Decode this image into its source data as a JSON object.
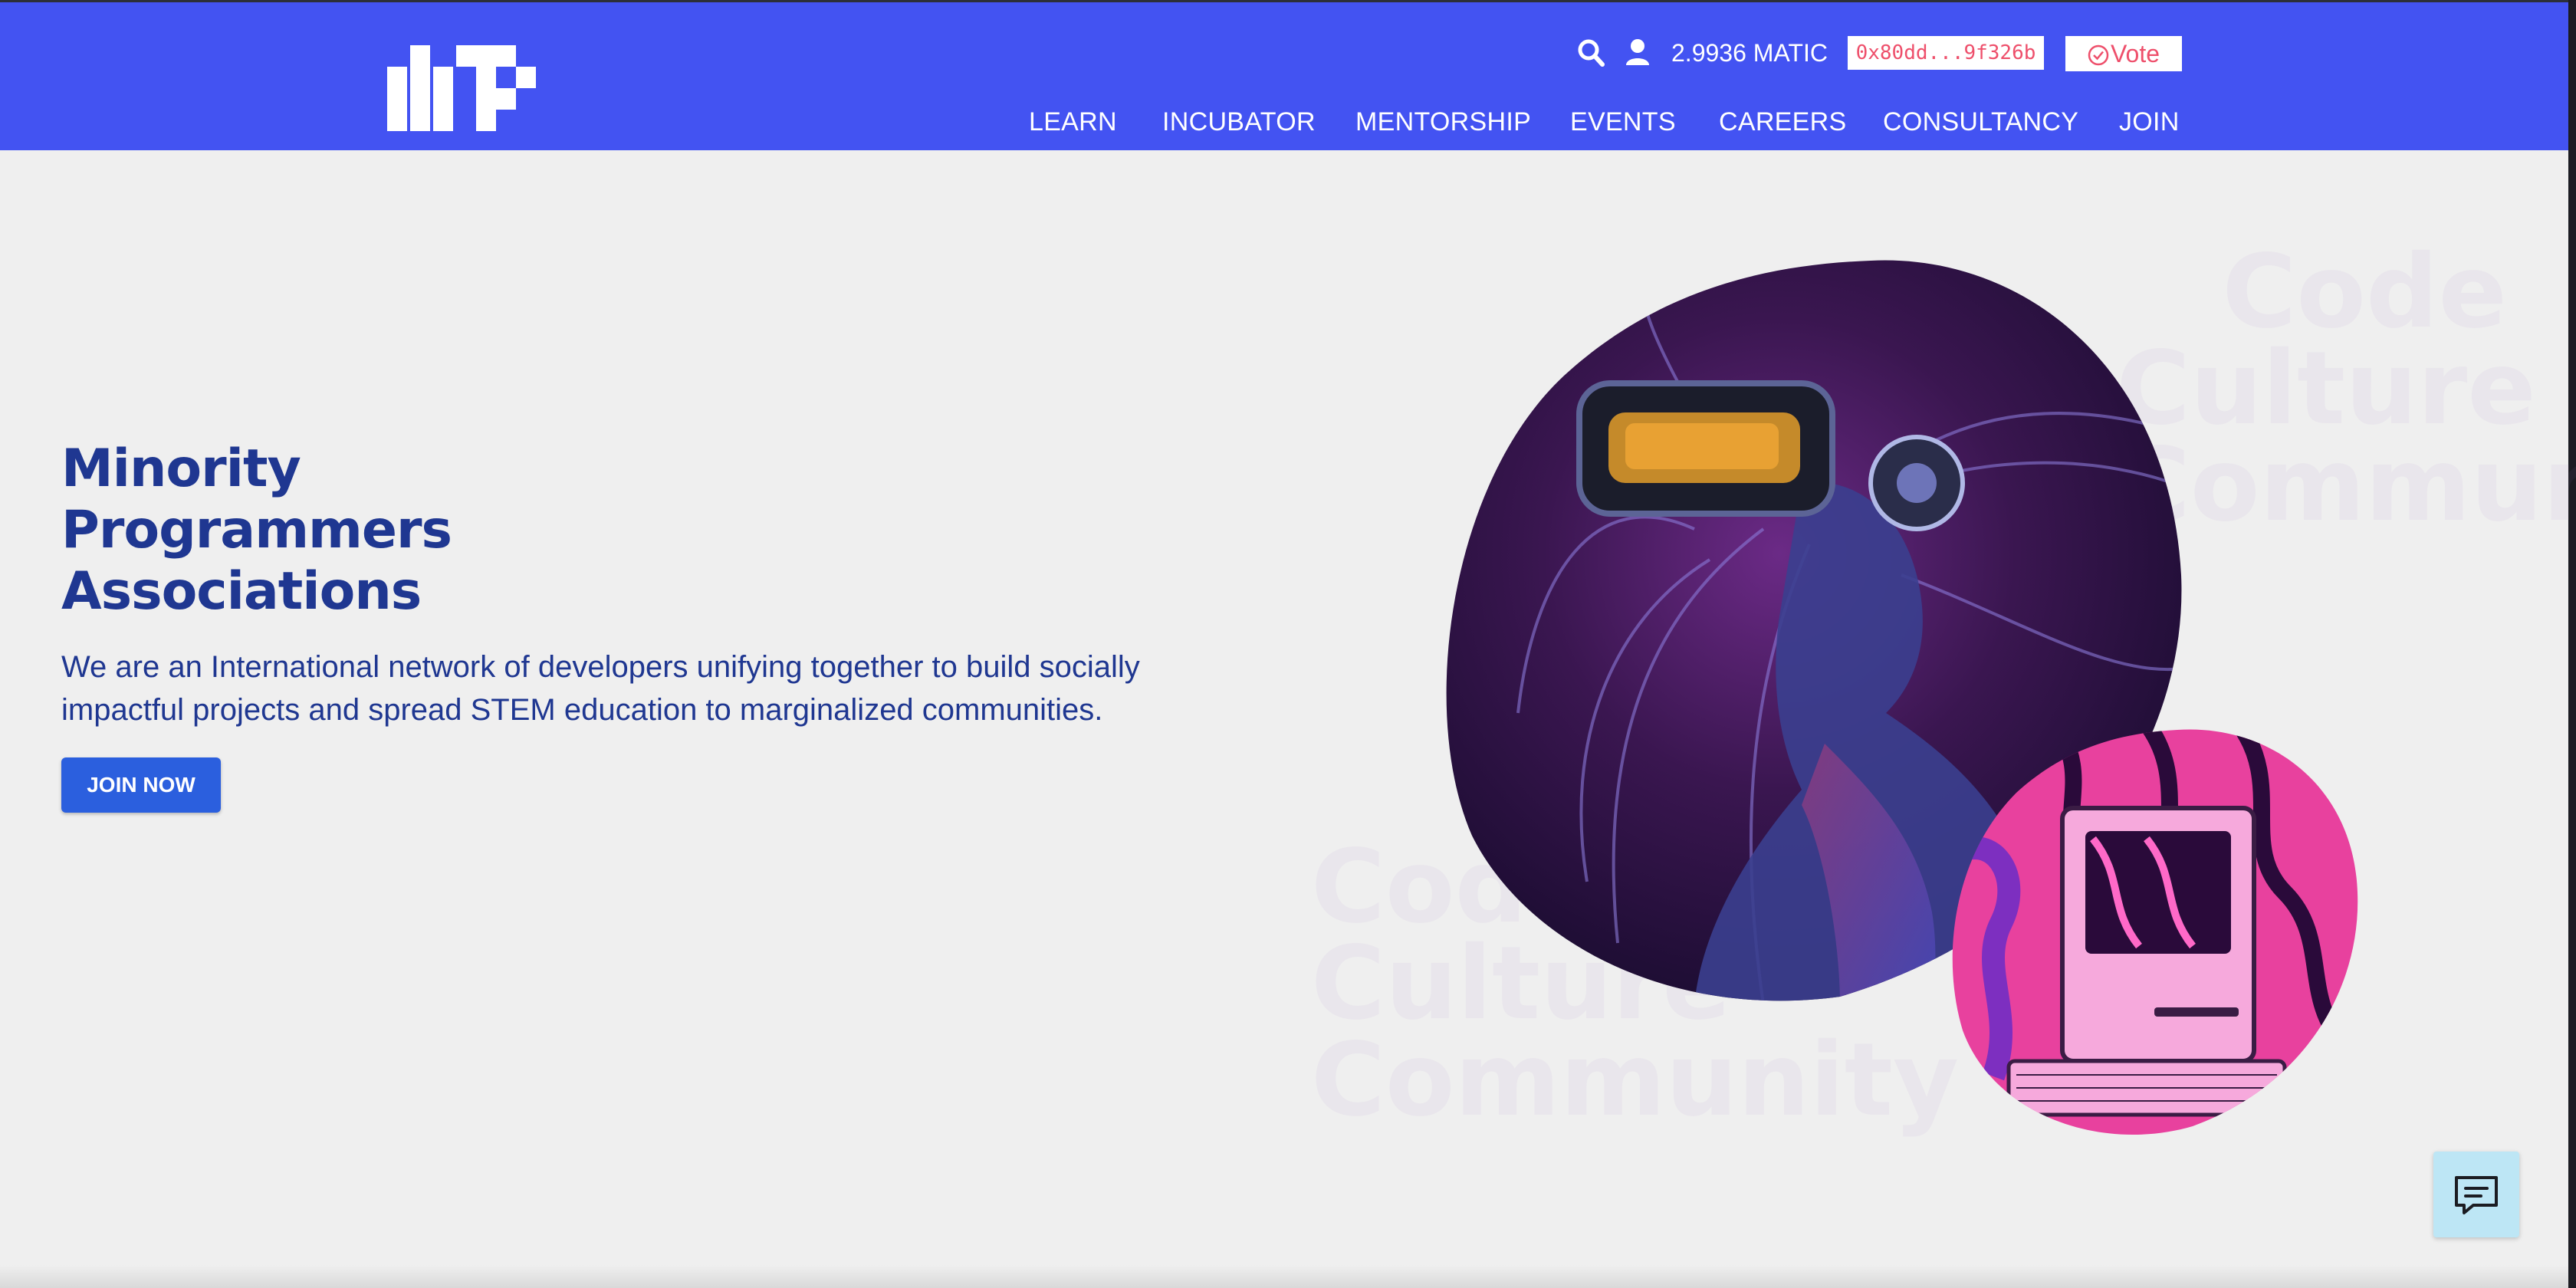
{
  "header": {
    "logo": "MP logo",
    "search_icon": "search-icon",
    "user_icon": "user-icon",
    "balance": "2.9936 MATIC",
    "wallet_address": "0x80dd...9f326b",
    "vote_label": "Vote",
    "vote_icon": "check-circle-icon",
    "nav": [
      "LEARN",
      "INCUBATOR",
      "MENTORSHIP",
      "EVENTS",
      "CAREERS",
      "CONSULTANCY",
      "JOIN"
    ],
    "bg_color": "#4353f2"
  },
  "hero": {
    "title_lines": [
      "Minority",
      "Programmers",
      "Associations"
    ],
    "subtitle": "We are an International network of developers unifying together to build socially impactful projects and spread STEM education to marginalized communities.",
    "cta_label": "JOIN NOW",
    "watermark_lines": [
      "Code",
      "Culture",
      "Community"
    ]
  },
  "chat_widget": {
    "icon": "chat-icon"
  },
  "colors": {
    "accent": "#2b5fde",
    "title": "#1f3791",
    "vote_text": "#ee4f6b",
    "chat_bg": "#bde6f5"
  }
}
